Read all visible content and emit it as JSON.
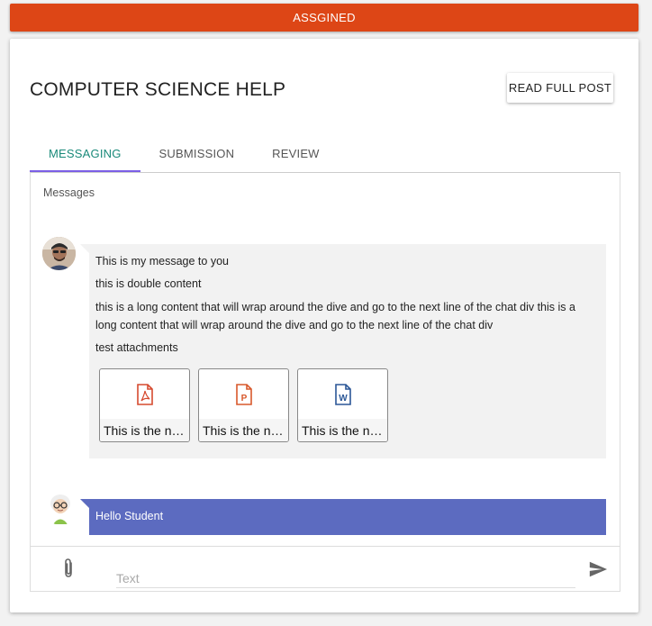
{
  "status": {
    "label": "ASSGINED",
    "color": "#dd4616"
  },
  "post": {
    "title": "COMPUTER SCIENCE HELP",
    "read_full_post_label": "READ FULL POST"
  },
  "tabs": [
    {
      "label": "MESSAGING",
      "active": true
    },
    {
      "label": "SUBMISSION",
      "active": false
    },
    {
      "label": "REVIEW",
      "active": false
    }
  ],
  "messages_panel": {
    "label": "Messages",
    "messages": [
      {
        "avatar": "user-photo-avatar",
        "lines": [
          "This is my message to you",
          "this is double content",
          "this is a long content that will wrap around the dive and go to the next line of the chat div this is a long content that will wrap around the dive and go to the next line of the chat div",
          "test attachments"
        ],
        "attachments": [
          {
            "icon": "pdf-file-icon",
            "name": "This is the name of the file"
          },
          {
            "icon": "ppt-file-icon",
            "name": "This is the name of the file"
          },
          {
            "icon": "word-file-icon",
            "name": "This is the name of the file"
          }
        ]
      },
      {
        "avatar": "tutor-cartoon-avatar",
        "text": "Hello Student",
        "color": "#5c6bc0"
      }
    ]
  },
  "composer": {
    "placeholder": "Text",
    "value": ""
  }
}
